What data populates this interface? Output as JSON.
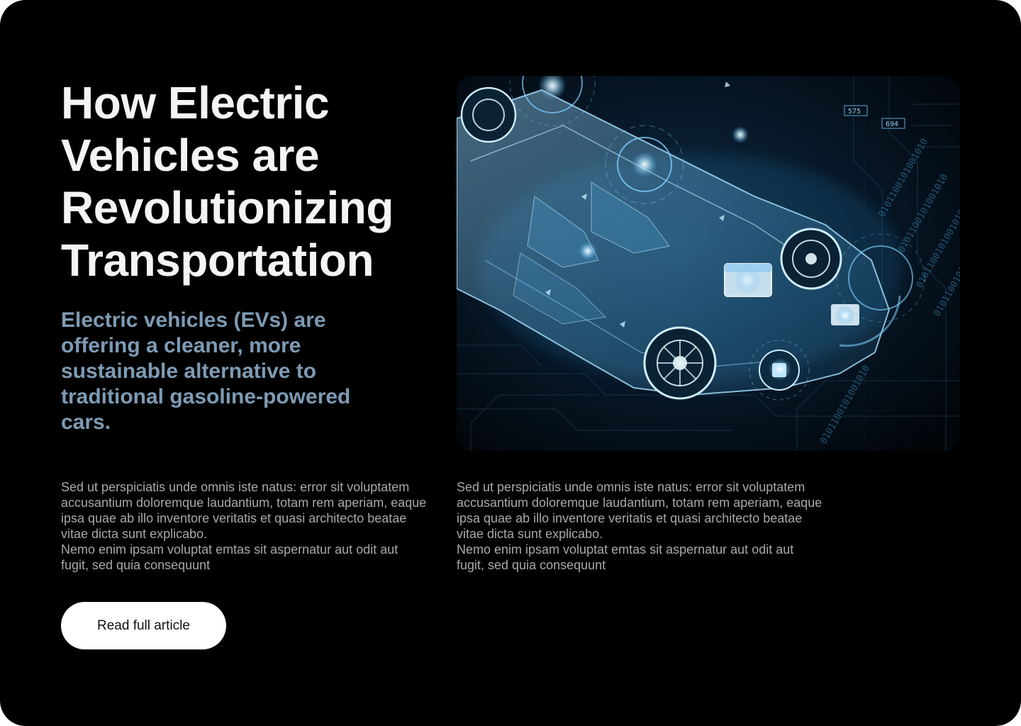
{
  "article": {
    "headline": "How Electric Vehicles are Revolutionizing Transportation",
    "subheading": "Electric vehicles (EVs) are offering a cleaner, more sustainable alternative to traditional gasoline-powered cars.",
    "body_left": "Sed ut perspiciatis unde omnis iste natus: error sit voluptatem accusantium doloremque laudantium, totam rem aperiam, eaque ipsa quae ab illo inventore veritatis et quasi architecto beatae vitae dicta sunt explicabo.\n Nemo enim ipsam voluptat emtas sit aspernatur aut odit aut fugit, sed quia consequunt",
    "body_right": "Sed ut perspiciatis unde omnis iste natus: error sit voluptatem accusantium doloremque laudantium, totam rem aperiam, eaque ipsa quae ab illo inventore veritatis et quasi architecto beatae vitae dicta sunt explicabo.\n Nemo enim ipsam voluptat emtas sit aspernatur aut odit aut fugit, sed quia consequunt",
    "cta_label": "Read full article"
  },
  "hero_image": {
    "subject": "car-xray-illustration",
    "hud_labels": [
      "575",
      "694"
    ],
    "binary_text": "0101100101001010"
  },
  "colors": {
    "background": "#000000",
    "headline": "#f4f4f4",
    "subheading": "#7d9bb4",
    "body_text": "#a8a8a8",
    "button_bg": "#ffffff",
    "button_text": "#111111",
    "glow": "#7fd0ff"
  }
}
